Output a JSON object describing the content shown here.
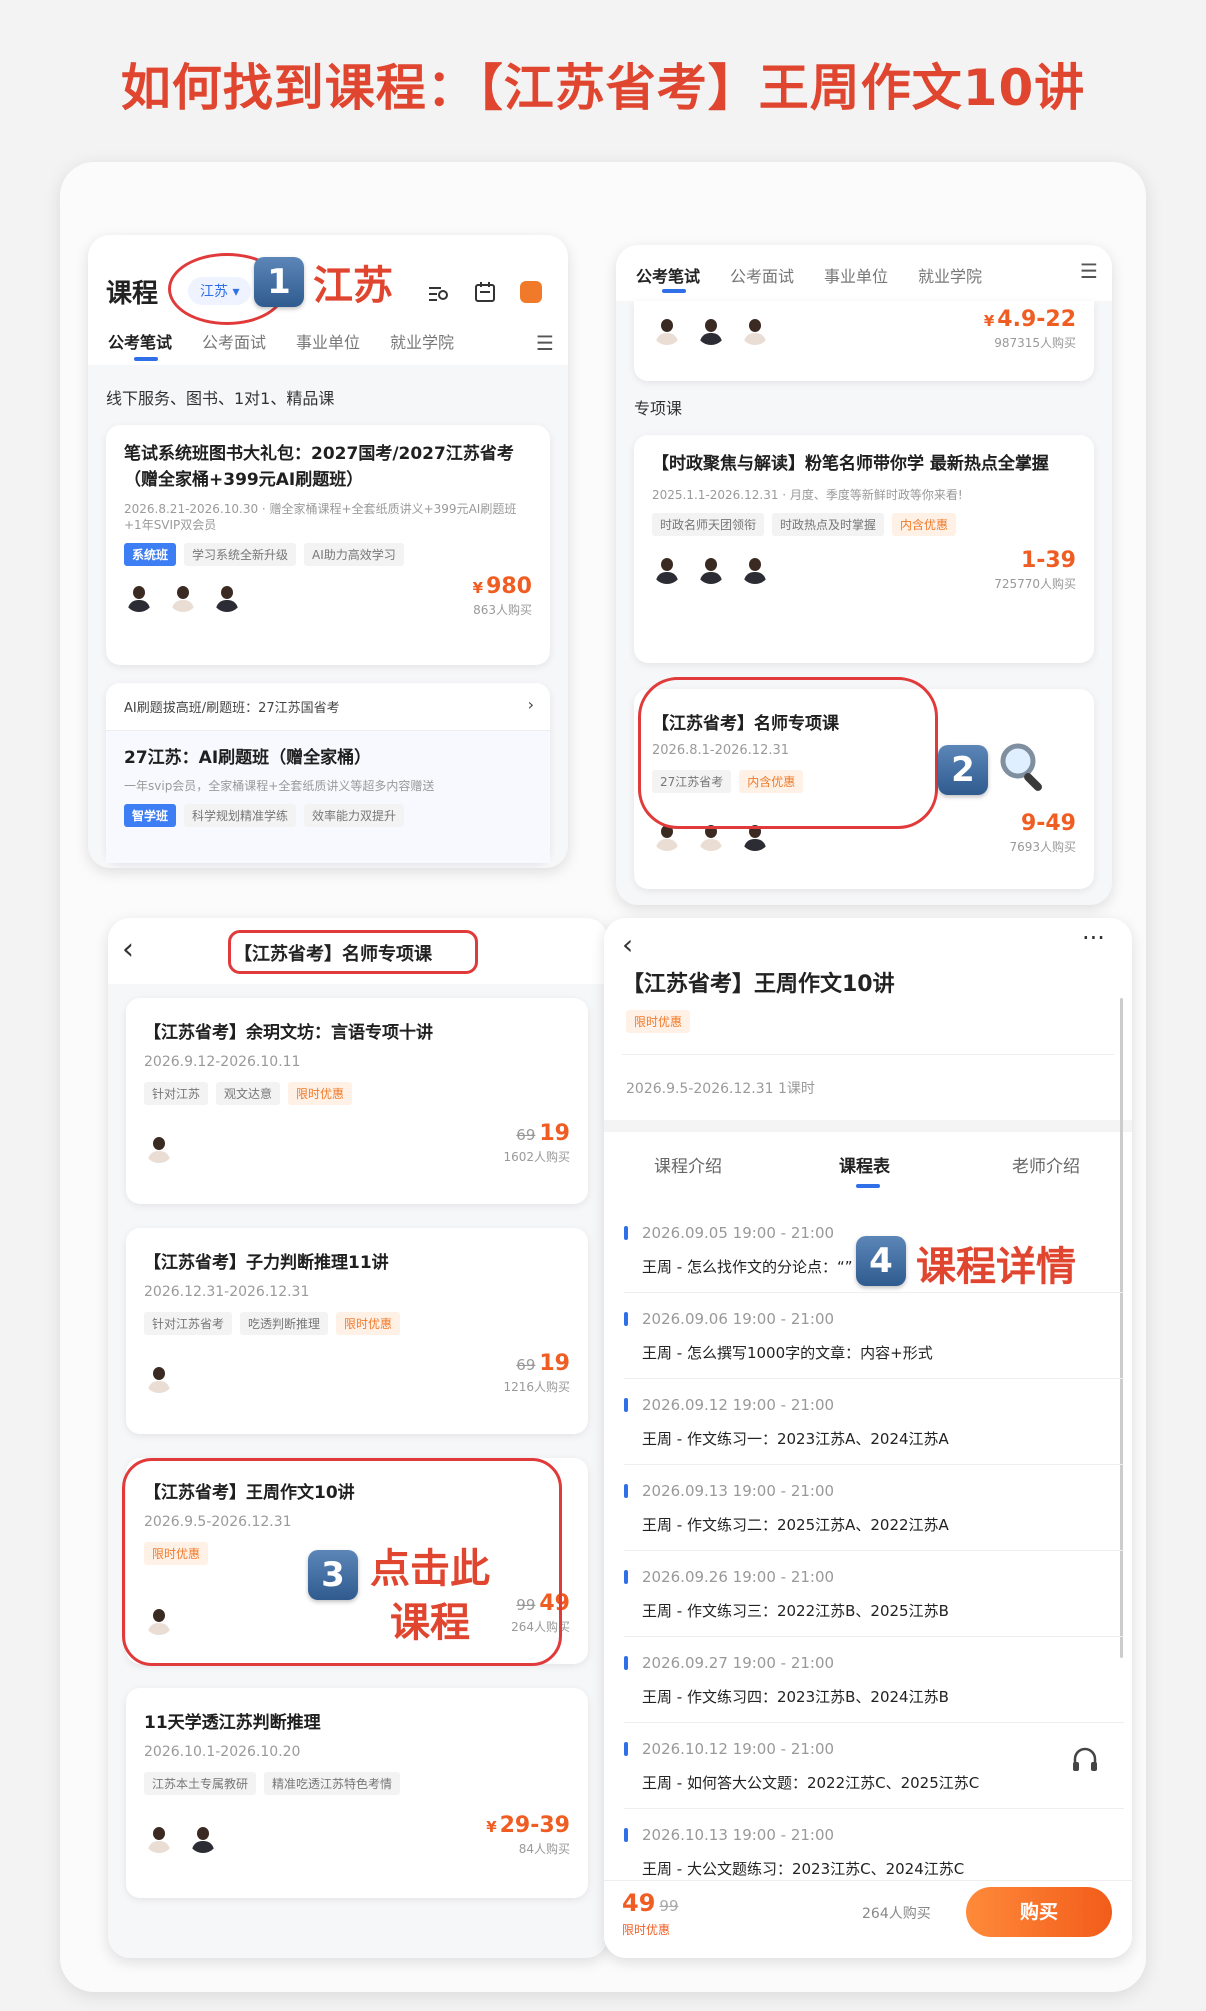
{
  "header": {
    "title": "如何找到课程：【江苏省考】王周作文10讲"
  },
  "colors": {
    "accent_red": "#e0452f",
    "price_orange": "#f05d23",
    "blue": "#2f6fe8"
  },
  "annotations": {
    "step1": {
      "num": "1",
      "text": "江苏"
    },
    "step2": {
      "num": "2"
    },
    "step3": {
      "num": "3",
      "line1": "点击此",
      "line2": "课程"
    },
    "step4": {
      "num": "4",
      "text": "课程详情"
    }
  },
  "panel1": {
    "title": "课程",
    "region": "江苏",
    "tabs": [
      "公考笔试",
      "公考面试",
      "事业单位",
      "就业学院"
    ],
    "section": "线下服务、图书、1对1、精品课",
    "card1": {
      "title": "笔试系统班图书大礼包：2027国考/2027江苏省考（赠全家桶+399元AI刷题班）",
      "date": "2026.8.21-2026.10.30 · 赠全家桶课程+全套纸质讲义+399元AI刷题班+1年SVIP双会员",
      "tags": [
        "系统班",
        "学习系统全新升级",
        "AI助力高效学习"
      ],
      "price": "980",
      "currency": "¥",
      "buyers": "863人购买"
    },
    "card2": {
      "header": "AI刷题拔高班/刷题班：27江苏国省考",
      "title": "27江苏：AI刷题班（赠全家桶）",
      "desc": "一年svip会员，全家桶课程+全套纸质讲义等超多内容赠送",
      "tags": [
        "智学班",
        "科学规划精准学练",
        "效率能力双提升"
      ]
    }
  },
  "panel2": {
    "tabs": [
      "公考笔试",
      "公考面试",
      "事业单位",
      "就业学院"
    ],
    "top_price": "4.9-22",
    "top_currency": "¥",
    "top_buyers": "987315人购买",
    "section": "专项课",
    "card1": {
      "title": "【时政聚焦与解读】粉笔名师带你学 最新热点全掌握",
      "date": "2025.1.1-2026.12.31 · 月度、季度等新鲜时政等你来看!",
      "tags": [
        "时政名师天团领衔",
        "时政热点及时掌握",
        "内含优惠"
      ],
      "price": "1-39",
      "buyers": "725770人购买"
    },
    "card2": {
      "title": "【江苏省考】名师专项课",
      "date": "2026.8.1-2026.12.31",
      "tags": [
        "27江苏省考",
        "内含优惠"
      ],
      "price": "9-49",
      "buyers": "7693人购买"
    }
  },
  "panel3": {
    "title": "【江苏省考】名师专项课",
    "courses": [
      {
        "title": "【江苏省考】余玥文坊：言语专项十讲",
        "date": "2026.9.12-2026.10.11",
        "tags": [
          "针对江苏",
          "观文达意",
          "限时优惠"
        ],
        "old": "69",
        "price": "19",
        "buyers": "1602人购买"
      },
      {
        "title": "【江苏省考】子力判断推理11讲",
        "date": "2026.12.31-2026.12.31",
        "tags": [
          "针对江苏省考",
          "吃透判断推理",
          "限时优惠"
        ],
        "old": "69",
        "price": "19",
        "buyers": "1216人购买"
      },
      {
        "title": "【江苏省考】王周作文10讲",
        "date": "2026.9.5-2026.12.31",
        "tags": [
          "限时优惠"
        ],
        "old": "99",
        "price": "49",
        "buyers": "264人购买"
      },
      {
        "title": "11天学透江苏判断推理",
        "date": "2026.10.1-2026.10.20",
        "tags": [
          "江苏本土专属教研",
          "精准吃透江苏特色考情"
        ],
        "price": "29-39",
        "currency": "¥",
        "buyers": "84人购买"
      }
    ]
  },
  "panel4": {
    "title": "【江苏省考】王周作文10讲",
    "promo": "限时优惠",
    "meta": "2026.9.5-2026.12.31  1课时",
    "tabs": [
      "课程介绍",
      "课程表",
      "老师介绍"
    ],
    "schedule": [
      {
        "time": "2026.09.05 19:00 - 21:00",
        "lesson": "王周 - 怎么找作文的分论点：“”"
      },
      {
        "time": "2026.09.06 19:00 - 21:00",
        "lesson": "王周 - 怎么撰写1000字的文章：内容+形式"
      },
      {
        "time": "2026.09.12 19:00 - 21:00",
        "lesson": "王周 - 作文练习一：2023江苏A、2024江苏A"
      },
      {
        "time": "2026.09.13 19:00 - 21:00",
        "lesson": "王周 - 作文练习二：2025江苏A、2022江苏A"
      },
      {
        "time": "2026.09.26 19:00 - 21:00",
        "lesson": "王周 - 作文练习三：2022江苏B、2025江苏B"
      },
      {
        "time": "2026.09.27 19:00 - 21:00",
        "lesson": "王周 - 作文练习四：2023江苏B、2024江苏B"
      },
      {
        "time": "2026.10.12 19:00 - 21:00",
        "lesson": "王周 - 如何答大公文题：2022江苏C、2025江苏C"
      },
      {
        "time": "2026.10.13 19:00 - 21:00",
        "lesson": "王周 - 大公文题练习：2023江苏C、2024江苏C"
      }
    ],
    "bottom": {
      "price": "49",
      "old": "99",
      "promo": "限时优惠",
      "buyers": "264人购买",
      "buy": "购买"
    }
  },
  "icons": [
    "search-icon",
    "calendar-icon",
    "chat-icon",
    "menu-icon",
    "back-icon",
    "more-icon",
    "magnifier-icon",
    "headphone-icon",
    "chevron-right-icon"
  ]
}
